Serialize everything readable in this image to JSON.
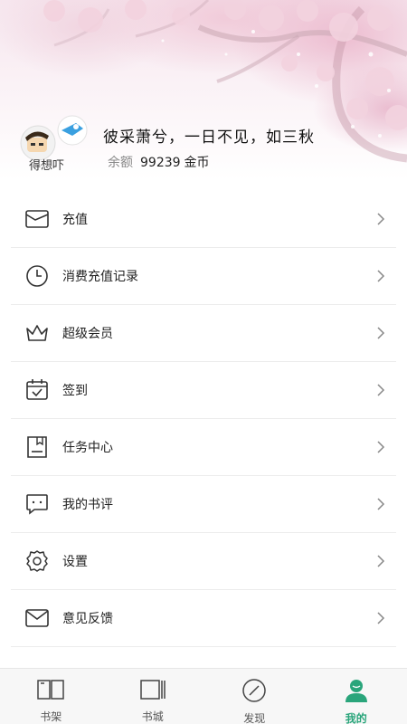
{
  "profile": {
    "avatar_caption": "得想吓",
    "username": "彼采萧兮，一日不见，如三秋",
    "balance_label": "余额",
    "balance_value": "99239",
    "balance_unit": "金币"
  },
  "menu": [
    {
      "label": "充值",
      "icon": "wallet-icon"
    },
    {
      "label": "消费充值记录",
      "icon": "clock-icon"
    },
    {
      "label": "超级会员",
      "icon": "crown-icon"
    },
    {
      "label": "签到",
      "icon": "calendar-check-icon"
    },
    {
      "label": "任务中心",
      "icon": "task-icon"
    },
    {
      "label": "我的书评",
      "icon": "comment-icon"
    },
    {
      "label": "设置",
      "icon": "gear-icon"
    },
    {
      "label": "意见反馈",
      "icon": "mail-icon"
    }
  ],
  "tabs": [
    {
      "label": "书架",
      "icon": "bookshelf-icon",
      "active": false
    },
    {
      "label": "书城",
      "icon": "bookstore-icon",
      "active": false
    },
    {
      "label": "发现",
      "icon": "compass-icon",
      "active": false
    },
    {
      "label": "我的",
      "icon": "user-icon",
      "active": true
    }
  ],
  "colors": {
    "accent": "#2aa57b",
    "icon_stroke": "#333333",
    "blossom": "#eab8cc"
  }
}
